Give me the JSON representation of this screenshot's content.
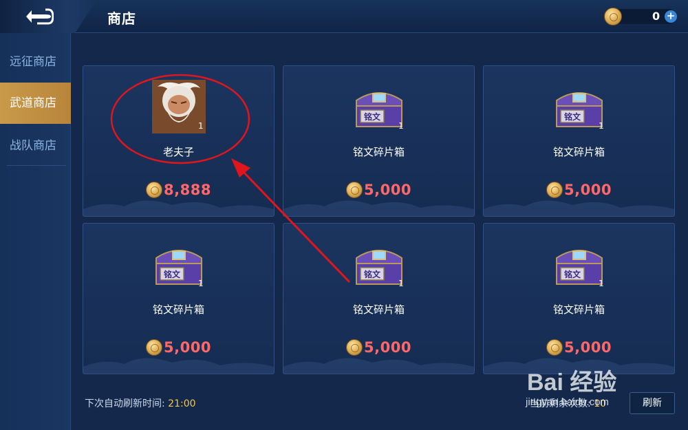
{
  "header": {
    "title": "商店",
    "currency_amount": "0",
    "currency_icon": "gold-coin-icon",
    "back_icon": "back-arrow-icon"
  },
  "sidebar": {
    "items": [
      {
        "label": "远征商店",
        "active": false
      },
      {
        "label": "武道商店",
        "active": true
      },
      {
        "label": "战队商店",
        "active": false
      }
    ]
  },
  "items": [
    {
      "name": "老夫子",
      "qty": "1",
      "price": "8,888",
      "icon": "hero-portrait-icon"
    },
    {
      "name": "铭文碎片箱",
      "qty": "1",
      "price": "5,000",
      "icon": "inscription-chest-icon",
      "chest_label": "铭文"
    },
    {
      "name": "铭文碎片箱",
      "qty": "1",
      "price": "5,000",
      "icon": "inscription-chest-icon",
      "chest_label": "铭文"
    },
    {
      "name": "铭文碎片箱",
      "qty": "1",
      "price": "5,000",
      "icon": "inscription-chest-icon",
      "chest_label": "铭文"
    },
    {
      "name": "铭文碎片箱",
      "qty": "1",
      "price": "5,000",
      "icon": "inscription-chest-icon",
      "chest_label": "铭文"
    },
    {
      "name": "铭文碎片箱",
      "qty": "1",
      "price": "5,000",
      "icon": "inscription-chest-icon",
      "chest_label": "铭文"
    }
  ],
  "footer": {
    "refresh_label": "下次自动刷新时间:",
    "refresh_time": "21:00",
    "remaining_label": "当前剩余次数:",
    "remaining_count": "10",
    "refresh_button": "刷新"
  },
  "watermark": {
    "brand": "Bai 经验",
    "url": "jingyan.baidu.com"
  },
  "colors": {
    "background": "#13284a",
    "price": "#ff6868",
    "highlight": "#f5c84b",
    "active_tab": "#c99a4a",
    "annotation": "#e0161c"
  }
}
